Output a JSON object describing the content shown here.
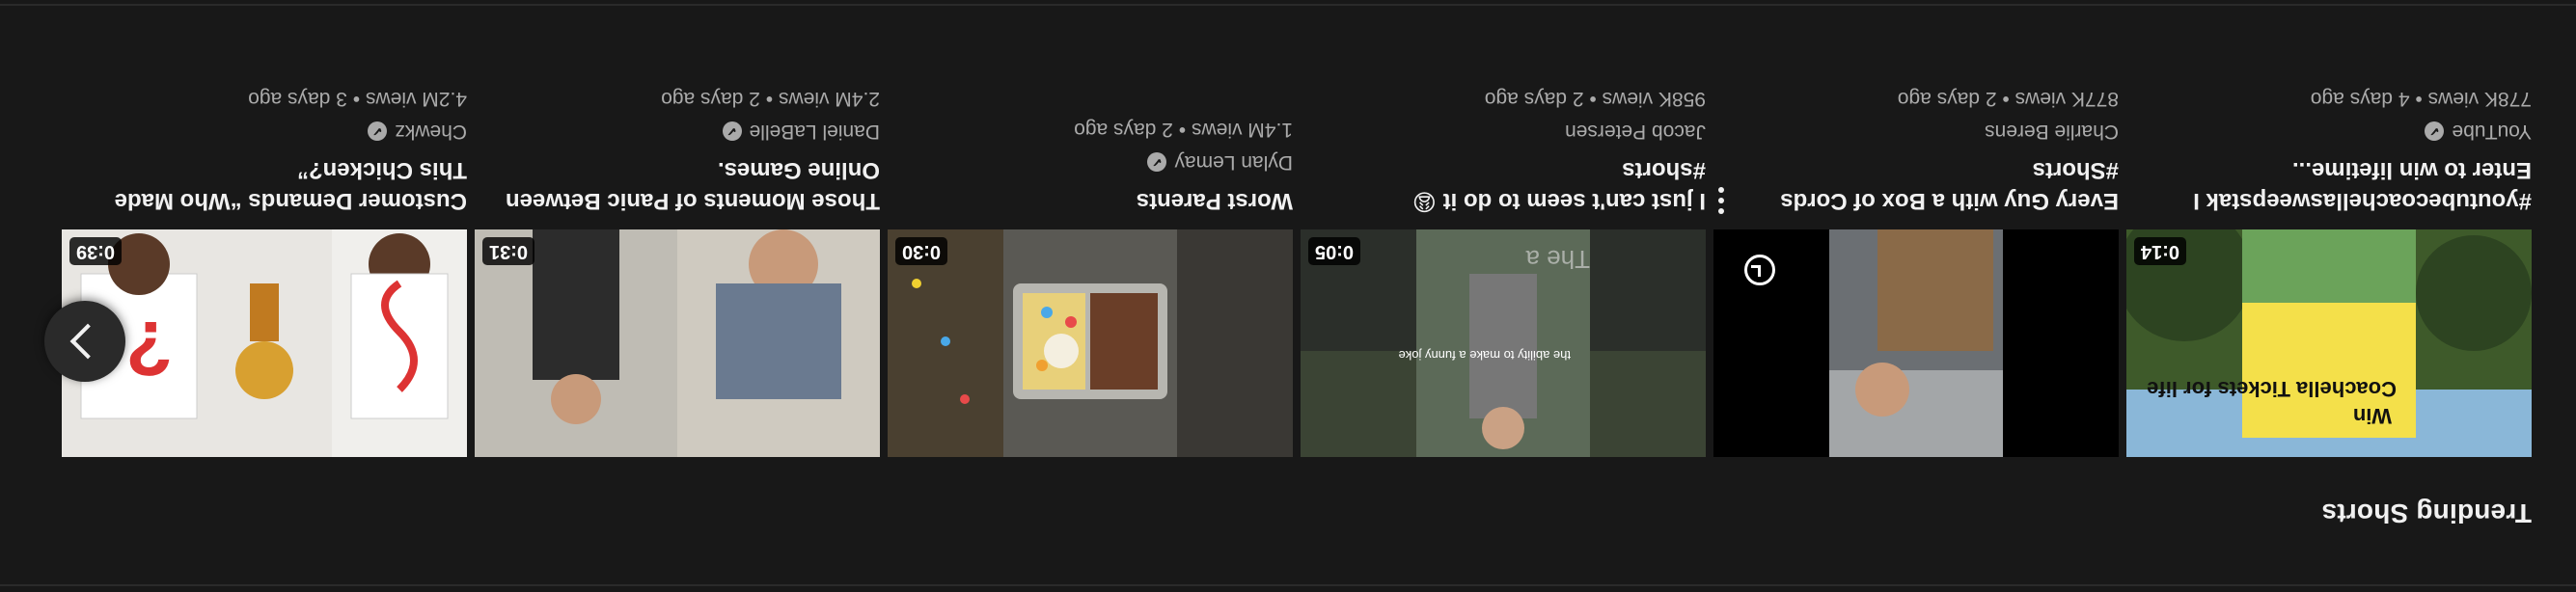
{
  "section": {
    "title": "Trending Shorts"
  },
  "cards": [
    {
      "title": "#youtubecoachellasweepstak I Enter to win lifetime...",
      "channel": "YouTube",
      "verified": true,
      "views": "778K views",
      "age": "4 days ago",
      "duration": "0:14",
      "thumb_text": "Coachella Tickets for life",
      "thumb_text_top": "Win"
    },
    {
      "title": "Every Guy with a Box of Cords #Shorts",
      "channel": "Charlie Berens",
      "verified": false,
      "views": "877K views",
      "age": "2 days ago",
      "duration": "",
      "thumb_text": ""
    },
    {
      "title": "I just can't seem to do it 😩 #shorts",
      "channel": "Jacob Petersen",
      "verified": false,
      "views": "958K views",
      "age": "2 days ago",
      "duration": "0:05",
      "thumb_text": "the ability to make a funny joke",
      "caption_text": "The a"
    },
    {
      "title": "Worst Parents",
      "channel": "Dylan Lemay",
      "verified": true,
      "views": "1.4M views",
      "age": "2 days ago",
      "duration": "0:30",
      "thumb_text": ""
    },
    {
      "title": "Those Moments of Panic Between Online Games.",
      "channel": "Daniel LaBelle",
      "verified": true,
      "views": "2.4M views",
      "age": "2 days ago",
      "duration": "0:31",
      "thumb_text": ""
    },
    {
      "title": "Customer Demands “Who Made This Chicken?”",
      "channel": "Chewkz",
      "verified": true,
      "views": "4.2M views",
      "age": "3 days ago",
      "duration": "0:39",
      "thumb_text": "?"
    }
  ],
  "separator": "•",
  "verified_glyph": "✔",
  "icons": {
    "more": "more-vert-icon",
    "watch_later": "clock-icon",
    "add_queue": "queue-icon",
    "next": "chevron-right-icon"
  },
  "colors": {
    "background": "#181818",
    "text": "#f1f1f1",
    "secondary_text": "#aaaaaa"
  }
}
